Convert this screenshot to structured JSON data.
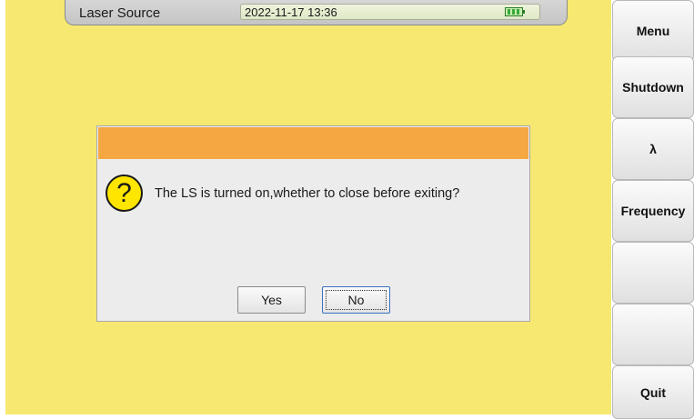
{
  "titlebar": {
    "app_title": "Laser Source",
    "datetime": "2022-11-17 13:36",
    "battery_icon": "battery-icon"
  },
  "dialog": {
    "icon": "question-icon",
    "icon_glyph": "?",
    "message": "The LS is turned on,whether to close before exiting?",
    "yes_label": "Yes",
    "no_label": "No"
  },
  "softkeys": [
    {
      "label": "Menu"
    },
    {
      "label": "Shutdown"
    },
    {
      "label": "λ"
    },
    {
      "label": "Frequency"
    },
    {
      "label": ""
    },
    {
      "label": ""
    },
    {
      "label": "Quit"
    }
  ],
  "colors": {
    "background": "#f6e871",
    "dialog_header": "#f5a842",
    "dialog_body": "#ececec",
    "question_icon": "#ffe600"
  }
}
